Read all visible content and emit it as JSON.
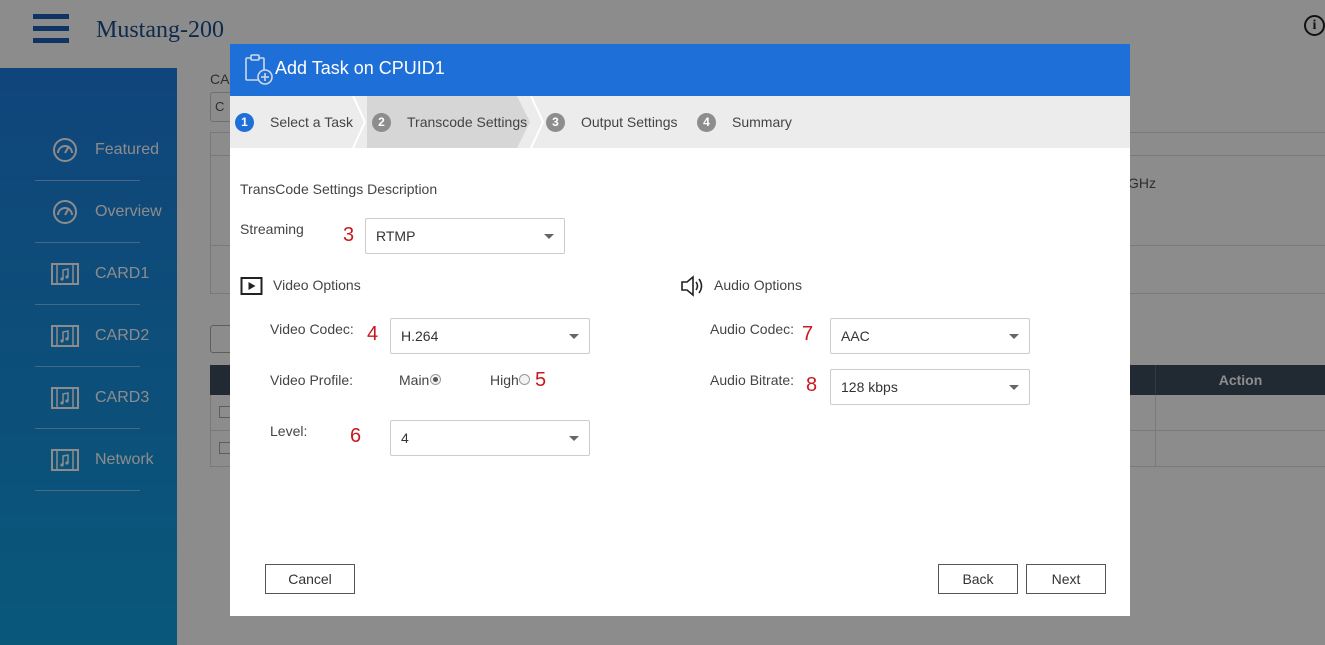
{
  "app": {
    "title": "Mustang-200"
  },
  "sidebar": {
    "items": [
      {
        "label": "Featured",
        "icon": "gauge-icon"
      },
      {
        "label": "Overview",
        "icon": "gauge-icon"
      },
      {
        "label": "CARD1",
        "icon": "film-card-icon"
      },
      {
        "label": "CARD2",
        "icon": "film-card-icon"
      },
      {
        "label": "CARD3",
        "icon": "film-card-icon"
      },
      {
        "label": "Network",
        "icon": "film-card-icon"
      }
    ]
  },
  "background": {
    "ca_label": "CA",
    "box_text": "C",
    "ghz_text": "GHz",
    "table_action_header": "Action"
  },
  "modal": {
    "title": "Add Task on CPUID1",
    "steps": [
      {
        "num": "1",
        "label": "Select a Task",
        "state": "done"
      },
      {
        "num": "2",
        "label": "Transcode Settings",
        "state": "current"
      },
      {
        "num": "3",
        "label": "Output Settings",
        "state": "pending"
      },
      {
        "num": "4",
        "label": "Summary",
        "state": "pending"
      }
    ],
    "description": "TransCode Settings Description",
    "streaming": {
      "label": "Streaming",
      "marker": "3",
      "value": "RTMP"
    },
    "video": {
      "title": "Video Options",
      "codec": {
        "label": "Video Codec:",
        "marker": "4",
        "value": "H.264"
      },
      "profile": {
        "label": "Video Profile:",
        "marker": "5",
        "options": [
          {
            "label": "Main",
            "checked": true
          },
          {
            "label": "High",
            "checked": false
          }
        ]
      },
      "level": {
        "label": "Level:",
        "marker": "6",
        "value": "4"
      }
    },
    "audio": {
      "title": "Audio Options",
      "codec": {
        "label": "Audio Codec:",
        "marker": "7",
        "value": "AAC"
      },
      "bitrate": {
        "label": "Audio Bitrate:",
        "marker": "8",
        "value": "128 kbps"
      }
    },
    "buttons": {
      "cancel": "Cancel",
      "back": "Back",
      "next": "Next"
    }
  },
  "colors": {
    "primary": "#1f6fd8",
    "marker": "#c8181e",
    "sidebar_top": "#1e7ee0",
    "sidebar_bottom": "#11a0de"
  }
}
